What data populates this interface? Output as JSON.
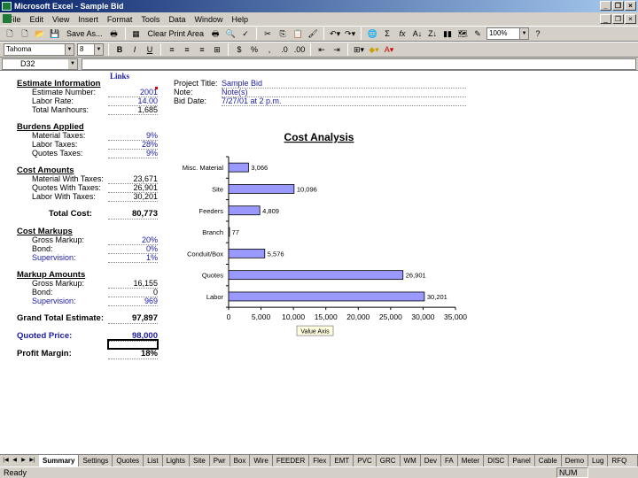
{
  "window": {
    "title": "Microsoft Excel - Sample Bid"
  },
  "menu": [
    "File",
    "Edit",
    "View",
    "Insert",
    "Format",
    "Tools",
    "Data",
    "Window",
    "Help"
  ],
  "toolbar1": {
    "save_as": "Save As...",
    "clear_print_area": "Clear Print Area",
    "zoom": "100%"
  },
  "toolbar2": {
    "font": "Tahoma",
    "size": "8"
  },
  "namebox": "D32",
  "links_label": "Links",
  "project": {
    "title_label": "Project Title:",
    "title_value": "Sample Bid",
    "note_label": "Note:",
    "note_value": "Note(s)",
    "biddate_label": "Bid Date:",
    "biddate_value": "7/27/01 at 2 p.m."
  },
  "estimate": {
    "header": "Estimate Information",
    "rows": [
      {
        "label": "Estimate Number:",
        "value": "2001"
      },
      {
        "label": "Labor Rate:",
        "value": "14.00"
      },
      {
        "label": "Total Manhours:",
        "value": "1,685"
      }
    ]
  },
  "burdens": {
    "header": "Burdens Applied",
    "rows": [
      {
        "label": "Material Taxes:",
        "value": "9%"
      },
      {
        "label": "Labor Taxes:",
        "value": "28%"
      },
      {
        "label": "Quotes Taxes:",
        "value": "9%"
      }
    ]
  },
  "cost_amounts": {
    "header": "Cost Amounts",
    "rows": [
      {
        "label": "Material With Taxes:",
        "value": "23,671"
      },
      {
        "label": "Quotes With Taxes:",
        "value": "26,901"
      },
      {
        "label": "Labor With Taxes:",
        "value": "30,201"
      }
    ]
  },
  "total_cost": {
    "label": "Total Cost:",
    "value": "80,773"
  },
  "cost_markups": {
    "header": "Cost Markups",
    "rows": [
      {
        "label": "Gross Markup:",
        "value": "20%"
      },
      {
        "label": "Bond:",
        "value": "0%"
      },
      {
        "label": "Supervision:",
        "value": "1%"
      }
    ]
  },
  "markup_amounts": {
    "header": "Markup Amounts",
    "rows": [
      {
        "label": "Gross Markup:",
        "value": "16,155"
      },
      {
        "label": "Bond:",
        "value": "0"
      },
      {
        "label": "Supervision:",
        "value": "969"
      }
    ]
  },
  "grand_total": {
    "label": "Grand Total Estimate:",
    "value": "97,897"
  },
  "quoted_price": {
    "label": "Quoted Price:",
    "value": "98,000"
  },
  "profit_margin": {
    "label": "Profit Margin:",
    "value": "18%"
  },
  "chart_data": {
    "type": "bar",
    "orientation": "horizontal",
    "title": "Cost Analysis",
    "categories": [
      "Misc. Material",
      "Site",
      "Feeders",
      "Branch",
      "Conduit/Box",
      "Quotes",
      "Labor"
    ],
    "values": [
      3066,
      10096,
      4809,
      77,
      5576,
      26901,
      30201
    ],
    "value_labels": [
      "3,066",
      "10,096",
      "4,809",
      "77",
      "5,576",
      "26,901",
      "30,201"
    ],
    "xlim": [
      0,
      35000
    ],
    "xticks": [
      "0",
      "5,000",
      "10,000",
      "15,000",
      "20,000",
      "25,000",
      "30,000",
      "35,000"
    ],
    "xtick_values": [
      0,
      5000,
      10000,
      15000,
      20000,
      25000,
      30000,
      35000
    ],
    "xlabel": "Value Axis",
    "bar_color": "#9999ff",
    "grid": false
  },
  "tabs": [
    "Summary",
    "Settings",
    "Quotes",
    "List",
    "Lights",
    "Site",
    "Pwr",
    "Box",
    "Wire",
    "FEEDER",
    "Flex",
    "EMT",
    "PVC",
    "GRC",
    "WM",
    "Dev",
    "FA",
    "Meter",
    "DISC",
    "Panel",
    "Cable",
    "Demo",
    "Lug",
    "RFQ Light"
  ],
  "status": {
    "text": "Ready",
    "num": "NUM"
  }
}
